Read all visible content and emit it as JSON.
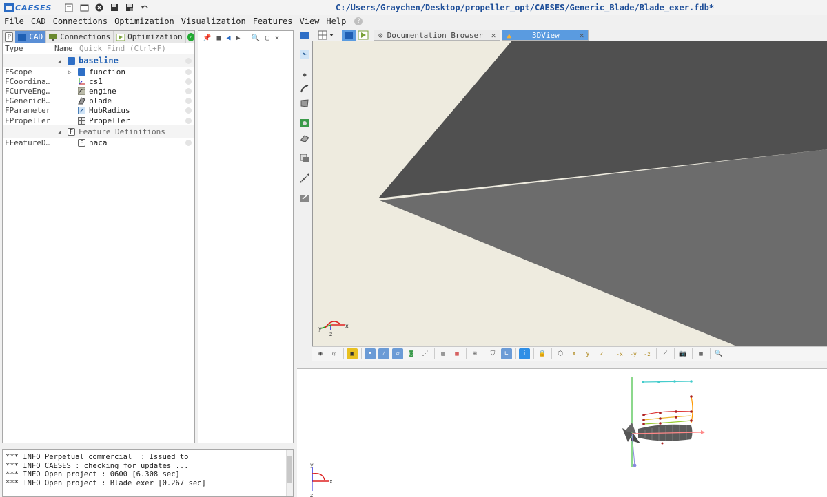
{
  "app": {
    "logo_text": "CAESES",
    "window_title": "C:/Users/Graychen/Desktop/propeller_opt/CAESES/Generic_Blade/Blade_exer.fdb*"
  },
  "menu": [
    "File",
    "CAD",
    "Connections",
    "Optimization",
    "Visualization",
    "Features",
    "View",
    "Help"
  ],
  "left_panel": {
    "tabs": {
      "p": "P",
      "cad": "CAD",
      "connections": "Connections",
      "optimization": "Optimization"
    },
    "columns": {
      "type": "Type",
      "name": "Name",
      "quick_find": "Quick Find (Ctrl+F)"
    },
    "baseline": "baseline",
    "rows": [
      {
        "type": "FScope",
        "name": "function"
      },
      {
        "type": "FCoordina…",
        "name": "cs1"
      },
      {
        "type": "FCurveEng…",
        "name": "engine"
      },
      {
        "type": "FGenericB…",
        "name": "blade"
      },
      {
        "type": "FParameter",
        "name": "HubRadius"
      },
      {
        "type": "FPropeller",
        "name": "Propeller"
      }
    ],
    "feature_group": "Feature Definitions",
    "feature_rows": [
      {
        "type": "FFeatureD…",
        "name": "naca"
      }
    ]
  },
  "console": {
    "lines": [
      "*** INFO Perpetual commercial  : Issued to",
      "*** INFO CAESES : checking for updates ...",
      "*** INFO Open project : 0600 [6.308 sec]",
      "*** INFO Open project : Blade_exer [0.267 sec]"
    ]
  },
  "viewport": {
    "tabs": {
      "doc": "Documentation Browser",
      "view3d": "3DView"
    },
    "axes": {
      "x": "x",
      "y": "y",
      "z": "z"
    },
    "colors": {
      "background": "#eeebdf",
      "upper_surface": "#505050",
      "lower_surface": "#6c6c6c",
      "accent": "#5a9be0"
    }
  },
  "bottom_toolbar": {
    "labels": [
      "-x",
      "-y",
      "-z",
      "x",
      "y",
      "z"
    ]
  }
}
